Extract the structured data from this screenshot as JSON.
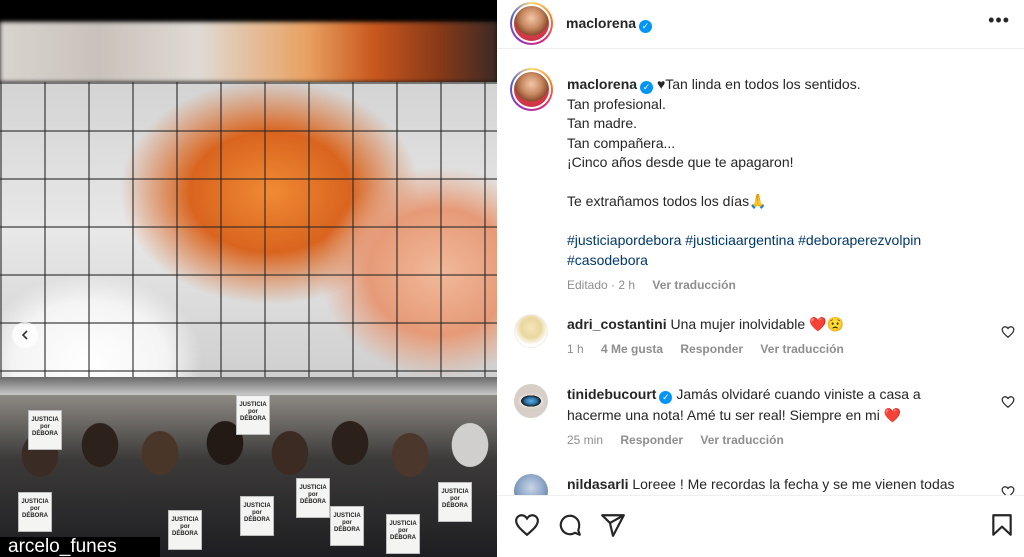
{
  "post": {
    "author": "maclorena",
    "more_icon": "more-horizontal-icon"
  },
  "caption": {
    "author": "maclorena",
    "heart_glyph": "♥",
    "lines": [
      "Tan linda en todos los sentidos.",
      "Tan profesional.",
      "Tan madre.",
      "Tan compañera...",
      "¡Cinco años desde que te apagaron!",
      "",
      "Te extrañamos todos los días"
    ],
    "pray_emoji": "🙏",
    "hashtags_line1": "#justiciapordebora #justiciaargentina #deboraperezvolpin",
    "hashtags_line2": "#casodebora",
    "edited": "Editado",
    "time": "2 h",
    "see_translation": "Ver traducción"
  },
  "comments": [
    {
      "user": "adri_costantini",
      "verified": false,
      "text_line1": "Una mujer inolvidable",
      "emojis": "❤️😟",
      "time": "1 h",
      "likes": "4 Me gusta",
      "reply": "Responder",
      "see_translation": "Ver traducción"
    },
    {
      "user": "tinidebucourt",
      "verified": true,
      "text_line1": "Jamás olvidaré cuando viniste a casa a",
      "text_line2": "hacerme una nota! Amé tu ser real! Siempre en mi",
      "emojis": "❤️",
      "time": "25 min",
      "reply": "Responder",
      "see_translation": "Ver traducción"
    },
    {
      "user": "nildasarli",
      "verified": false,
      "text_line1": "Loreee ! Me recordas la fecha y se me vienen todas"
    }
  ],
  "media": {
    "caption_overlay": "arcelo_funes",
    "signs": [
      "JUSTICIA por DÉBORA"
    ]
  },
  "colors": {
    "link": "#00376b",
    "verified": "#0095f6",
    "secondary_text": "#8e8e8e",
    "heart": "#ed4956"
  }
}
